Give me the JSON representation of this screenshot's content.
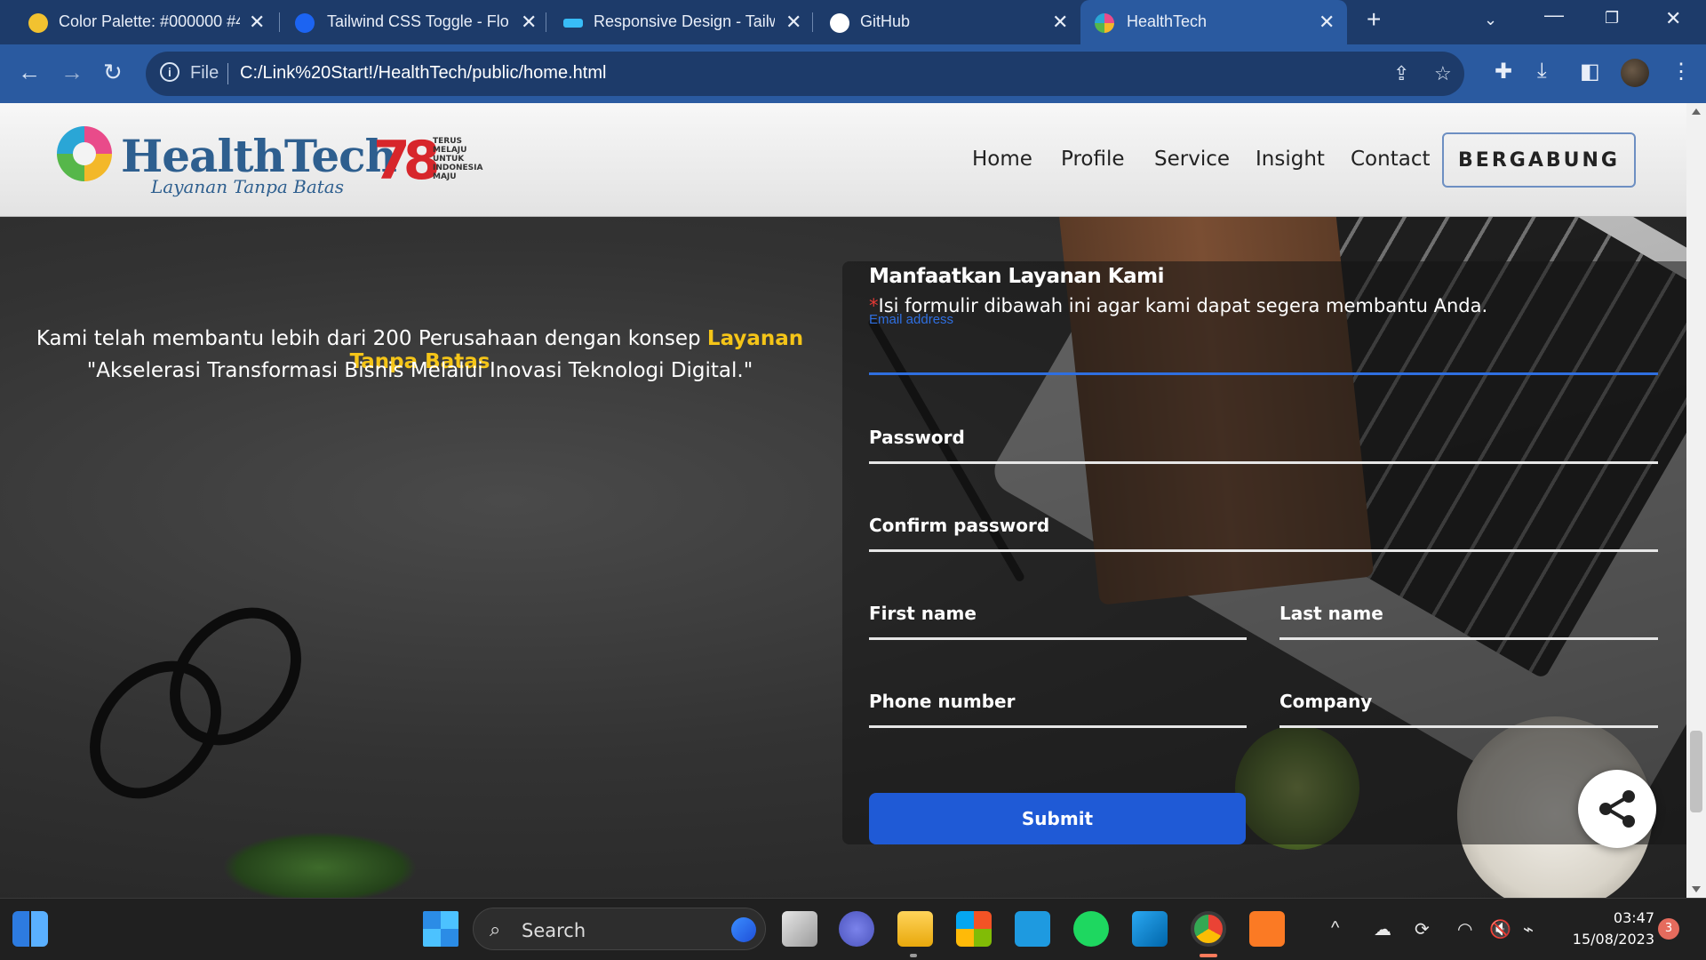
{
  "browser": {
    "tabs": [
      {
        "title": "Color Palette: #000000 #4",
        "favicon_color": "#f2c230"
      },
      {
        "title": "Tailwind CSS Toggle - Flov",
        "favicon_color": "#1c64f2"
      },
      {
        "title": "Responsive Design - Tailw",
        "favicon_color": "#38bdf8"
      },
      {
        "title": "GitHub",
        "favicon_color": "#ffffff"
      },
      {
        "title": "HealthTech",
        "favicon_color": "#e94b8a"
      }
    ],
    "new_tab_icon": "plus-icon",
    "address": {
      "scheme_label": "File",
      "url": "C:/Link%20Start!/HealthTech/public/home.html"
    }
  },
  "site": {
    "logo_title": "HealthTech",
    "logo_tagline": "Layanan Tanpa Batas",
    "ri_number": "78",
    "ri_text": "TERUS MELAJU UNTUK INDONESIA MAJU",
    "nav": [
      "Home",
      "Profile",
      "Service",
      "Insight",
      "Contact"
    ],
    "join_label": "BERGABUNG"
  },
  "hero": {
    "line1_prefix": "Kami telah membantu lebih dari 200 Perusahaan dengan konsep ",
    "line1_highlight": "Layanan Tanpa Batas",
    "line2": "\"Akselerasi Transformasi Bisnis Melalui Inovasi Teknologi Digital.\"",
    "highlight_color": "#f5c518"
  },
  "form": {
    "title": "Manfaatkan Layanan Kami",
    "subtitle_marker": "*",
    "subtitle": "Isi formulir dibawah ini agar kami dapat segera membantu Anda.",
    "email_label": "Email address",
    "password_label": "Password",
    "confirm_label": "Confirm password",
    "first_name_label": "First name",
    "last_name_label": "Last name",
    "phone_label": "Phone number",
    "company_label": "Company",
    "submit_label": "Submit",
    "accent_color": "#1f5ad6"
  },
  "taskbar": {
    "search_label": "Search",
    "time": "03:47",
    "date": "15/08/2023",
    "notification_count": "3"
  }
}
